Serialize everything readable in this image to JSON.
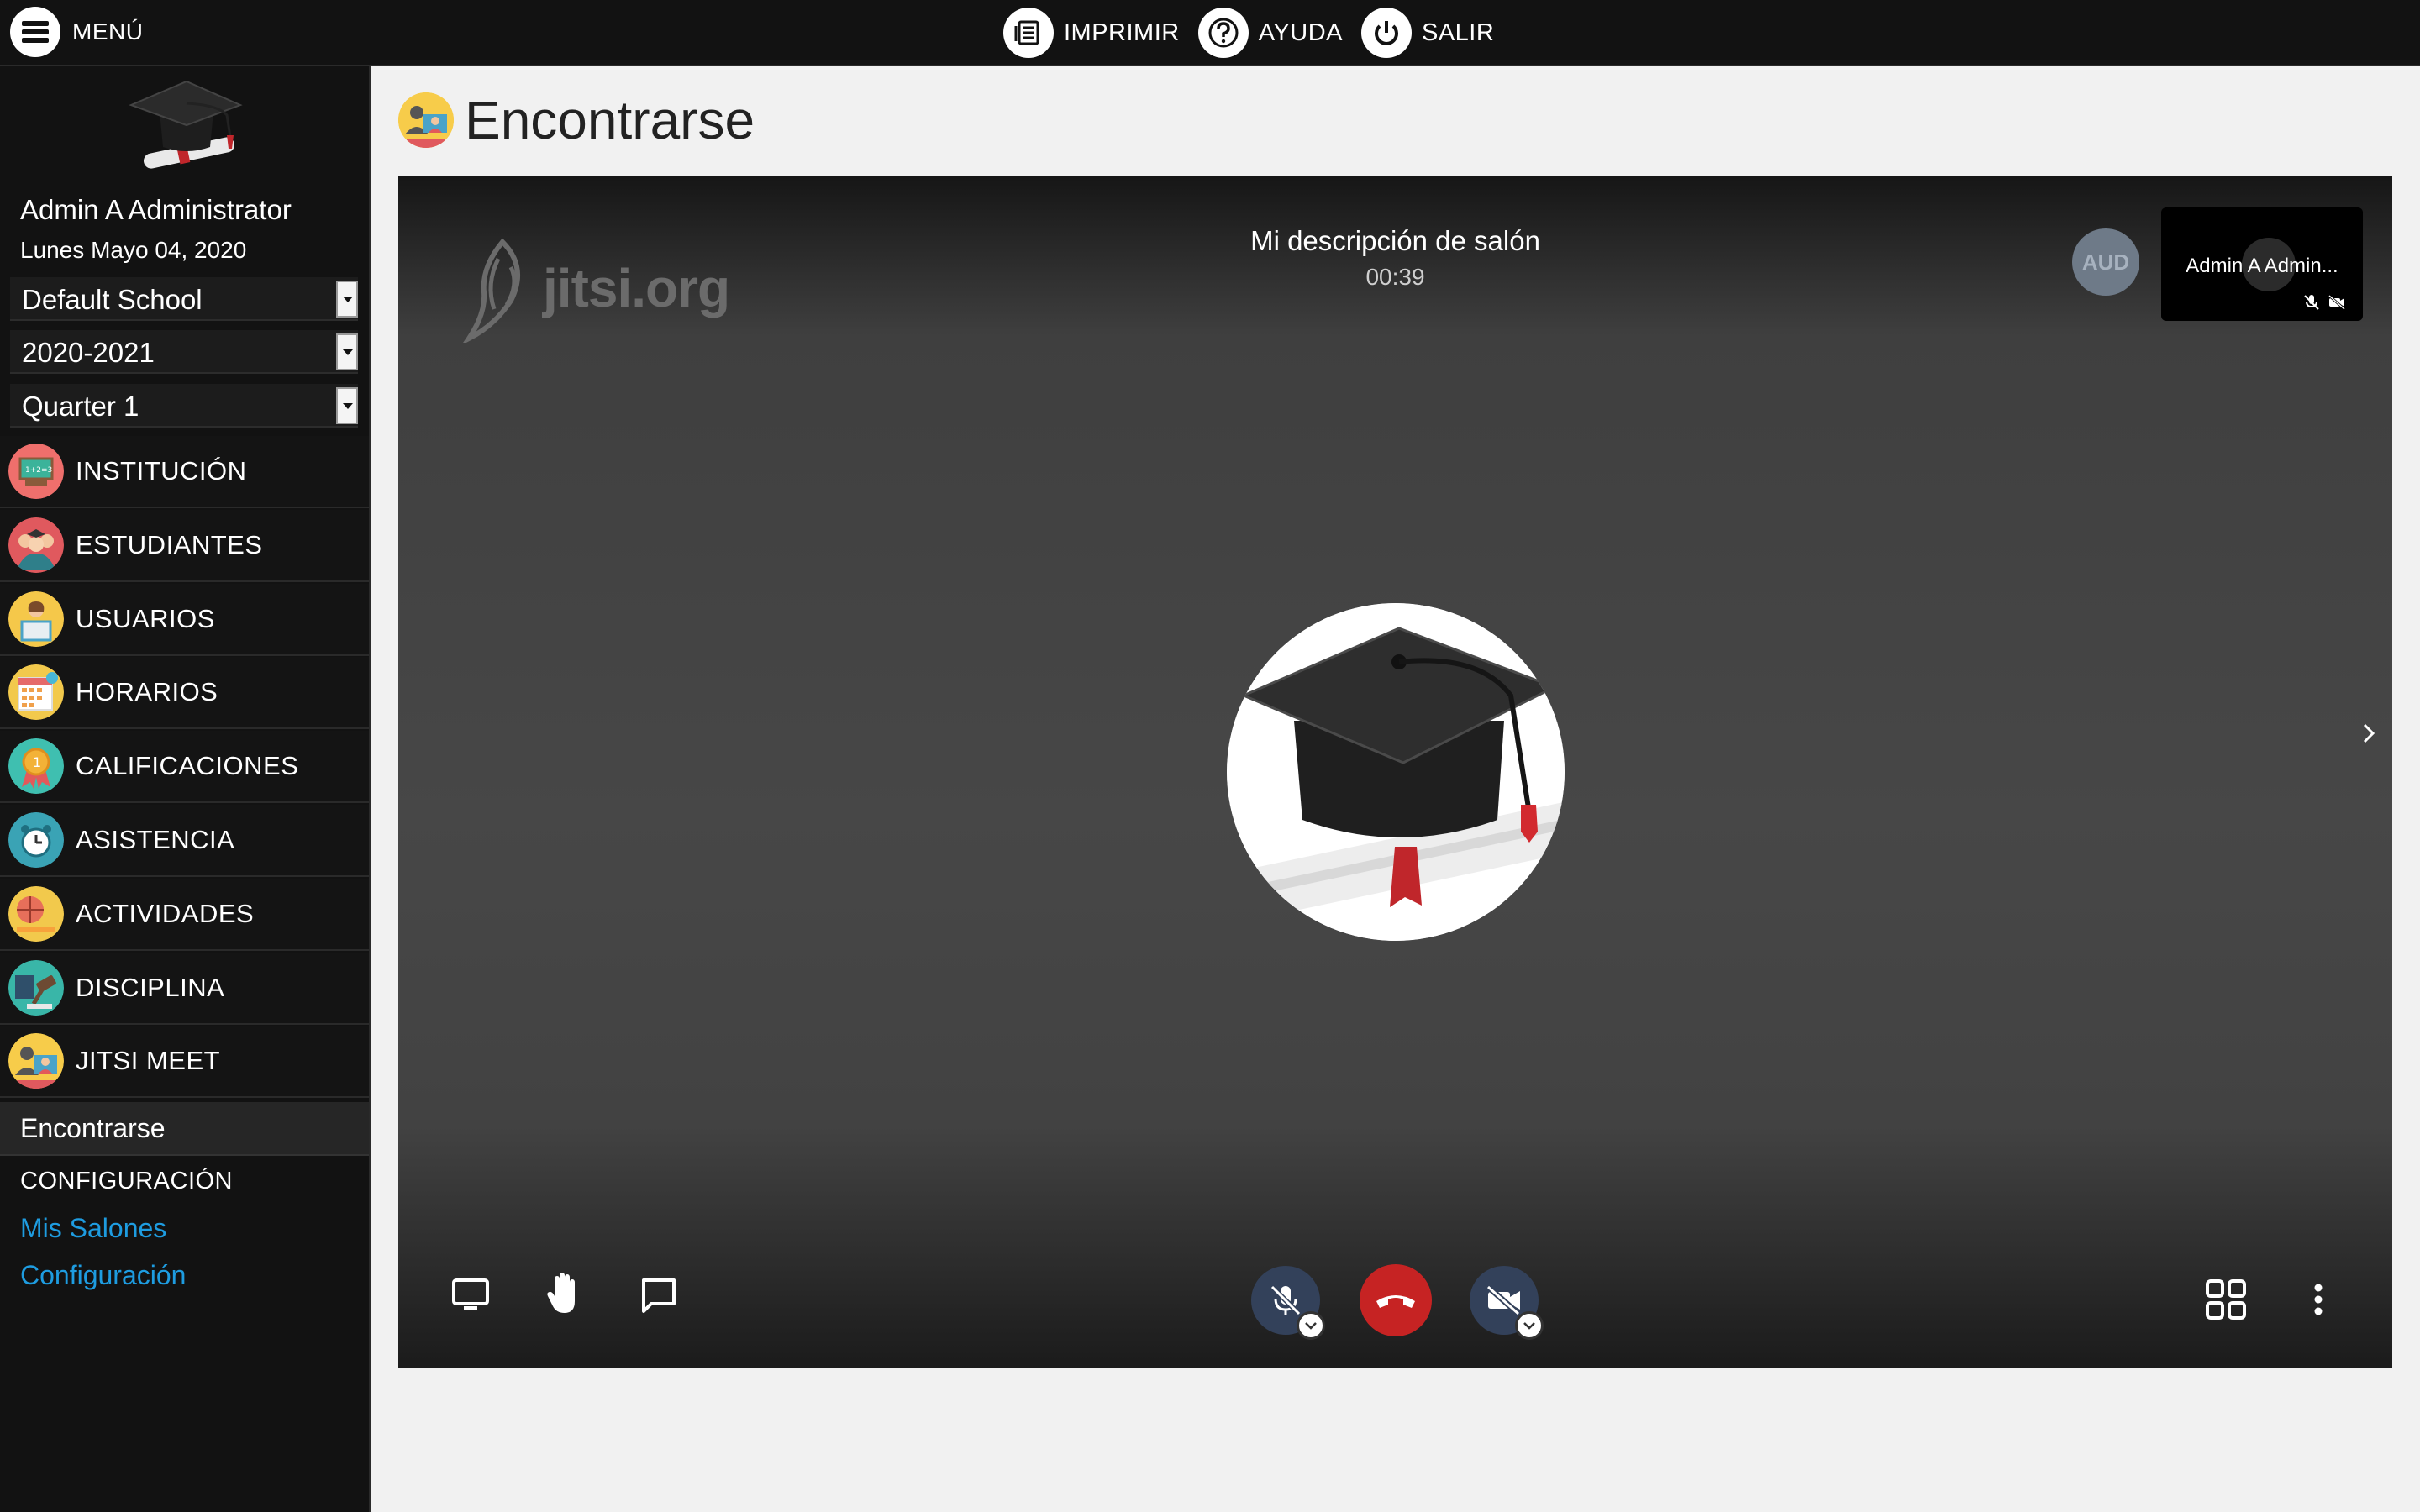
{
  "topbar": {
    "menu_label": "MENÚ",
    "actions": [
      {
        "label": "IMPRIMIR",
        "icon": "print-icon"
      },
      {
        "label": "AYUDA",
        "icon": "help-icon"
      },
      {
        "label": "SALIR",
        "icon": "power-icon"
      }
    ]
  },
  "sidebar": {
    "user_name": "Admin A Administrator",
    "date": "Lunes Mayo 04, 2020",
    "selects": {
      "school": "Default School",
      "year": "2020-2021",
      "term": "Quarter 1"
    },
    "nav": [
      {
        "label": "INSTITUCIÓN",
        "icon": "school-board-icon",
        "color": "#ef6f6c"
      },
      {
        "label": "ESTUDIANTES",
        "icon": "students-icon",
        "color": "#e0595e"
      },
      {
        "label": "USUARIOS",
        "icon": "user-computer-icon",
        "color": "#f5c84a"
      },
      {
        "label": "HORARIOS",
        "icon": "calendar-icon",
        "color": "#f2c94c"
      },
      {
        "label": "CALIFICACIONES",
        "icon": "medal-icon",
        "color": "#3fbfb0"
      },
      {
        "label": "ASISTENCIA",
        "icon": "alarm-clock-icon",
        "color": "#3aa3b5"
      },
      {
        "label": "ACTIVIDADES",
        "icon": "basketball-icon",
        "color": "#f2c94c"
      },
      {
        "label": "DISCIPLINA",
        "icon": "gavel-icon",
        "color": "#39b6a8"
      },
      {
        "label": "JITSI MEET",
        "icon": "meeting-icon",
        "color": "#f7cc4a"
      }
    ],
    "submenu": {
      "active": "Encontrarse",
      "section_header": "CONFIGURACIÓN",
      "links": [
        "Mis Salones",
        "Configuración"
      ]
    }
  },
  "main": {
    "title": "Encontrarse",
    "meeting": {
      "brand": "jitsi.org",
      "room_title": "Mi descripción de salón",
      "timer": "00:39",
      "audio_badge": "AUD",
      "participant_name": "Admin A Admin...",
      "accent_hangup": "#c62323"
    }
  }
}
